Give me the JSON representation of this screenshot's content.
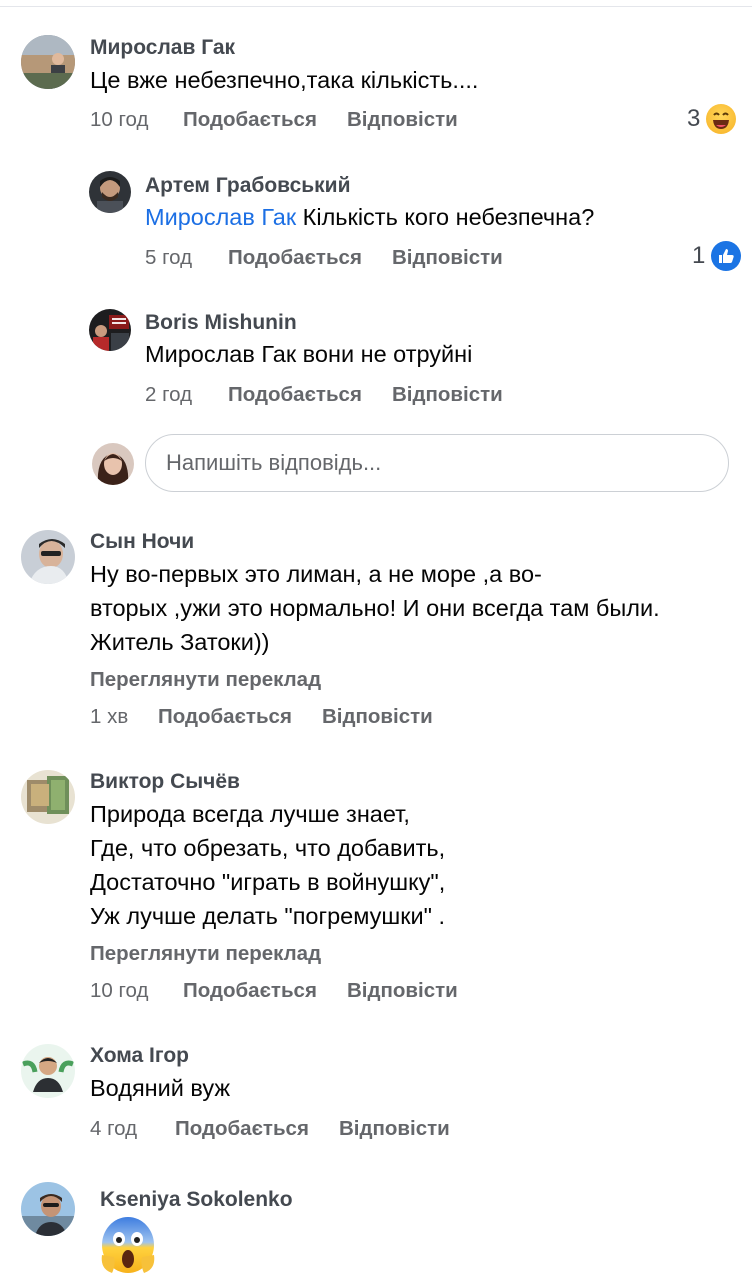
{
  "actions": {
    "like": "Подобається",
    "reply": "Відповісти",
    "translate": "Переглянути переклад"
  },
  "reply_placeholder": "Напишіть відповідь...",
  "comments": [
    {
      "author": "Мирослав Гак",
      "text": "Це вже небезпечно,така кількість....",
      "time": "10 год",
      "reaction_count": "3",
      "reaction": "haha-icon"
    },
    {
      "author": "Артем Грабовський",
      "mention": "Мирослав Гак",
      "text": " Кількість кого небезпечна?",
      "time": "5 год",
      "reaction_count": "1",
      "reaction": "like-icon"
    },
    {
      "author": "Boris Mishunin",
      "text": "Мирослав Гак вони не отруйні",
      "time": "2 год"
    },
    {
      "author": "Сын Ночи",
      "lines": [
        "Ну во-первых это лиман, а не море ,а во-",
        "вторых ,ужи это нормально! И они всегда там были.",
        "Житель Затоки))"
      ],
      "time": "1 хв"
    },
    {
      "author": "Виктор Сычёв",
      "lines": [
        "Природа всегда лучше знает,",
        "Где, что обрезать, что добавить,",
        "Достаточно \"играть в войнушку\",",
        "Уж лучше делать \"погремушки\" ."
      ],
      "time": "10 год"
    },
    {
      "author": "Хома Ігор",
      "text": "Водяний вуж",
      "time": "4 год"
    },
    {
      "author": "Kseniya Sokolenko",
      "emoji": "screaming-face-icon"
    }
  ],
  "colors": {
    "name": "#444950",
    "meta": "#65676b",
    "mention": "#1c6fe4",
    "like_blue": "#1b74e4",
    "border": "#ccd0d5"
  }
}
